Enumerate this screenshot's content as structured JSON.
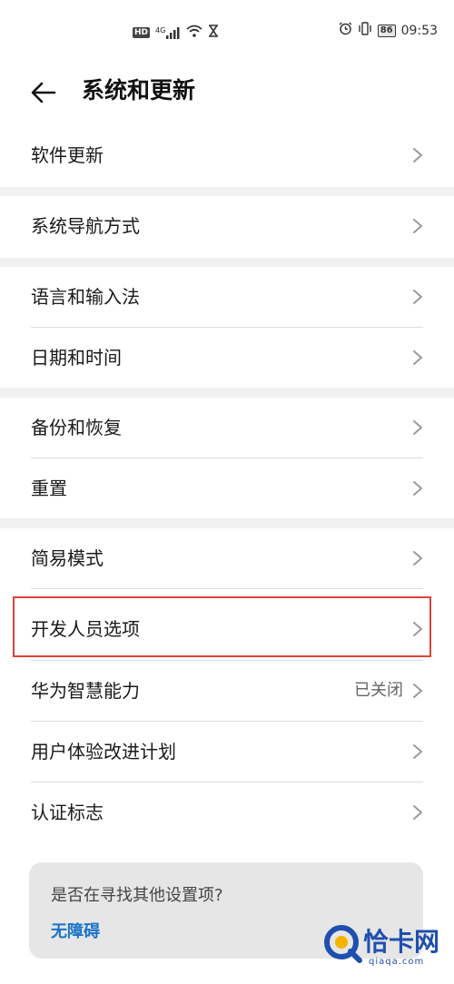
{
  "status_bar": {
    "hd_label": "HD",
    "network_label": "4G",
    "battery": "86",
    "time": "09:53"
  },
  "header": {
    "title": "系统和更新",
    "back_icon": "arrow-left-icon"
  },
  "items": [
    {
      "label": "软件更新"
    },
    {
      "label": "系统导航方式"
    },
    {
      "label": "语言和输入法"
    },
    {
      "label": "日期和时间"
    },
    {
      "label": "备份和恢复"
    },
    {
      "label": "重置"
    },
    {
      "label": "简易模式"
    },
    {
      "label": "开发人员选项"
    },
    {
      "label": "华为智慧能力",
      "value": "已关闭"
    },
    {
      "label": "用户体验改进计划"
    },
    {
      "label": "认证标志"
    }
  ],
  "suggestion_card": {
    "question": "是否在寻找其他设置项?",
    "link": "无障碍"
  },
  "watermark": {
    "name": "恰卡网",
    "domain": "qiaqa.com"
  },
  "colors": {
    "accent": "#1a73c9",
    "highlight": "#d9433a",
    "background": "#f1f1f1"
  }
}
